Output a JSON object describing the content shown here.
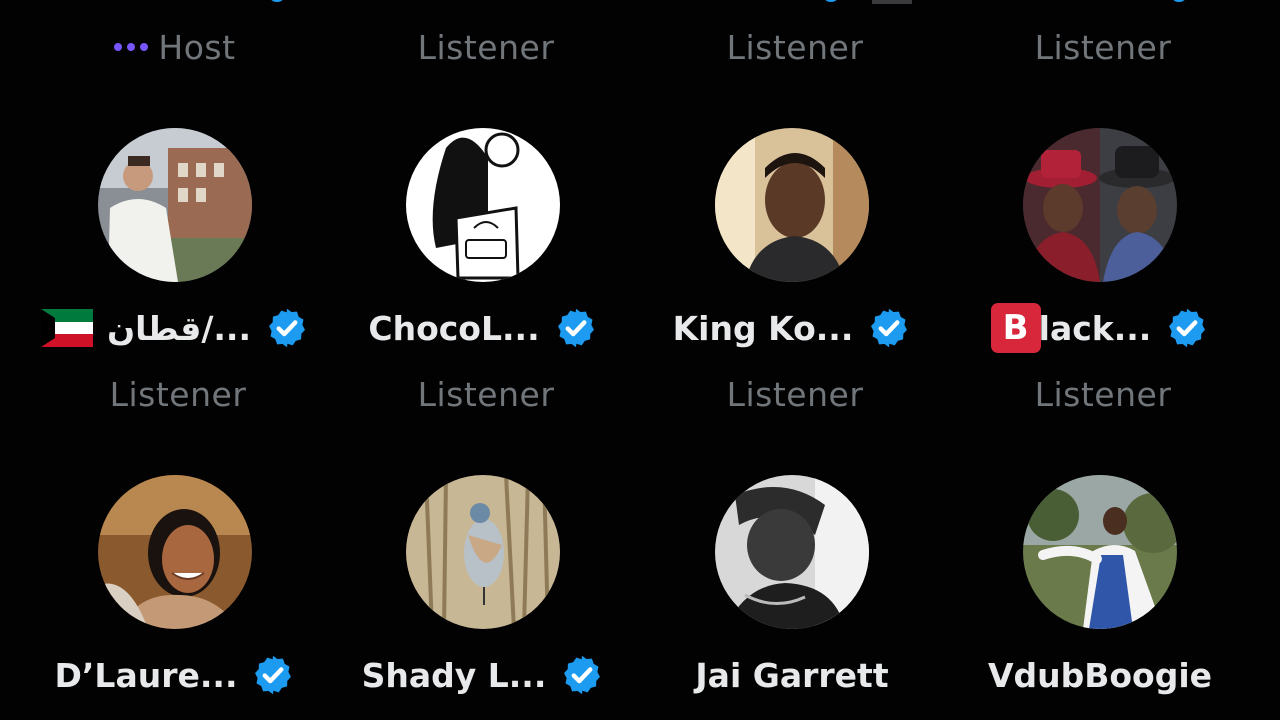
{
  "roles_row1": [
    "Host",
    "Listener",
    "Listener",
    "Listener"
  ],
  "participants": [
    {
      "name": "قطان/...",
      "role": "Listener",
      "verified": true,
      "prefix": "kuwait-flag-icon"
    },
    {
      "name": "ChocoL...",
      "role": "Listener",
      "verified": true
    },
    {
      "name": "King Ko...",
      "role": "Listener",
      "verified": true
    },
    {
      "name": "lack...",
      "badge_letter": "B",
      "role": "Listener",
      "verified": true
    },
    {
      "name": "D’Laure...",
      "verified": true
    },
    {
      "name": "Shady L...",
      "verified": true
    },
    {
      "name": "Jai Garrett",
      "verified": false
    },
    {
      "name": "VdubBoogie",
      "verified": false
    }
  ],
  "colors": {
    "background": "#020203",
    "role_text": "#71767b",
    "name_text": "#e7e9ea",
    "verified": "#1d9bf0",
    "host_dots": "#7856ff",
    "b_badge": "#d8263b"
  }
}
